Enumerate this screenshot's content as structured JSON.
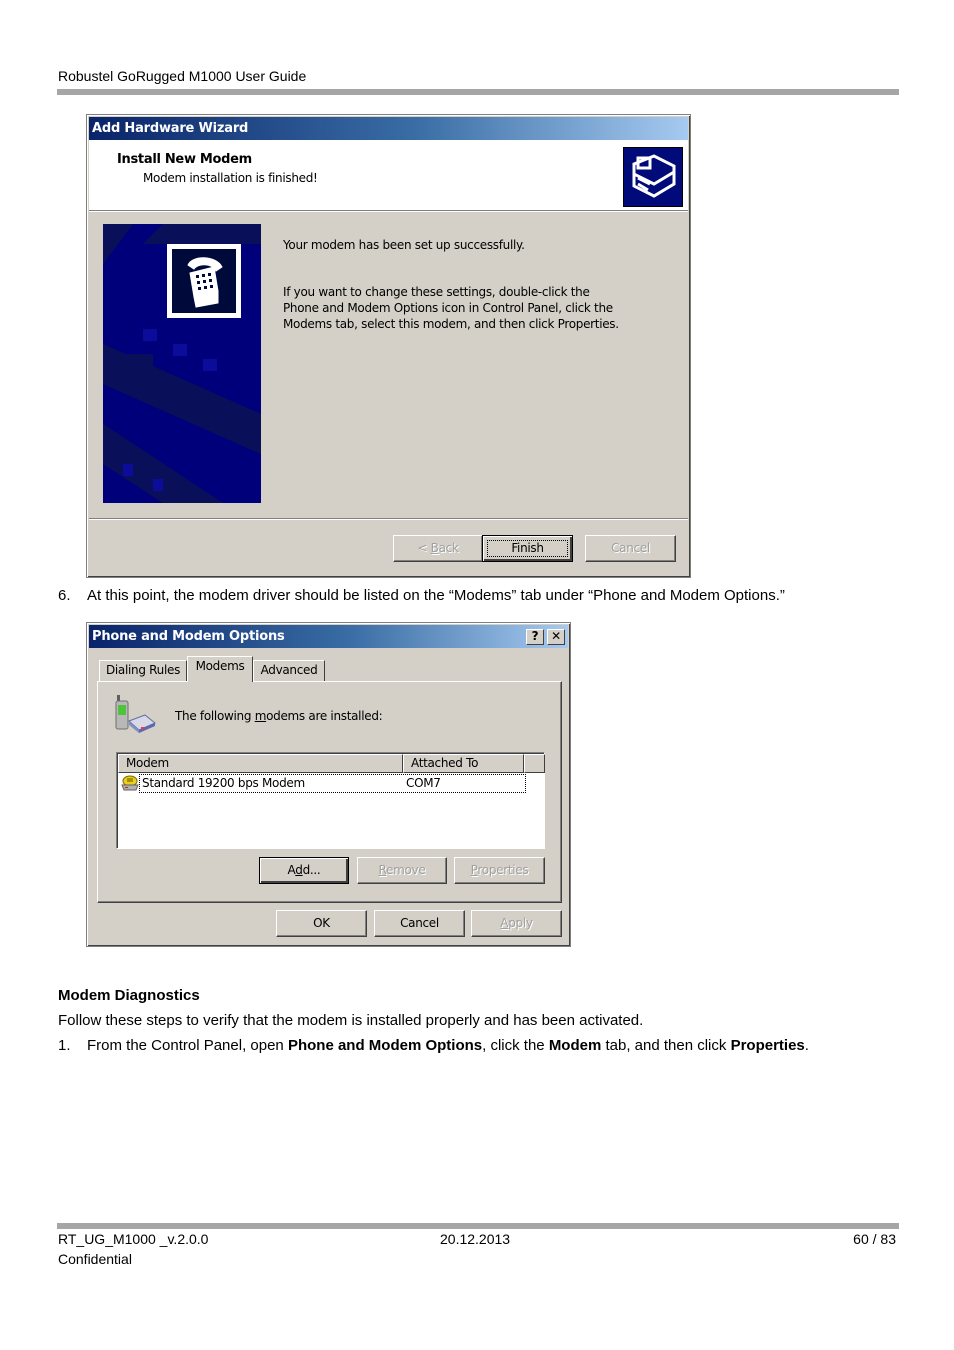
{
  "document": {
    "header_title": "Robustel GoRugged M1000 User Guide",
    "footer": {
      "doc_id": "RT_UG_M1000 _v.2.0.0",
      "date": "20.12.2013",
      "page": "60 / 83",
      "classification": "Confidential"
    }
  },
  "wizard": {
    "title": "Add Hardware Wizard",
    "heading": "Install New Modem",
    "subheading": "Modem installation is finished!",
    "header_icon": "hardware-install-icon",
    "side_icon": "telephone-icon",
    "message1": "Your modem has been set up successfully.",
    "message2_lines": [
      "If you want to change these settings, double-click the",
      "Phone and Modem Options icon in Control Panel, click the",
      "Modems tab, select this modem, and then click Properties."
    ],
    "buttons": {
      "back": {
        "pre": "< ",
        "accel": "B",
        "rest": "ack",
        "enabled": false
      },
      "finish": {
        "label": "Finish",
        "enabled": true
      },
      "cancel": {
        "label": "Cancel",
        "enabled": false
      }
    }
  },
  "step6": {
    "number": "6.",
    "text": "At this point, the modem driver should be listed on the “Modems” tab under “Phone and Modem Options.”"
  },
  "phone_dialog": {
    "title": "Phone and Modem Options",
    "help_label": "?",
    "close_label": "✕",
    "tabs": [
      {
        "label": "Dialing Rules",
        "active": false
      },
      {
        "label": "Modems",
        "active": true
      },
      {
        "label": "Advanced",
        "active": false
      }
    ],
    "intro": {
      "pre": "The following ",
      "accel": "m",
      "rest": "odems are  installed:"
    },
    "intro_icon": "phone-modem-icon",
    "list": {
      "columns": [
        "Modem",
        "Attached To"
      ],
      "rows": [
        {
          "icon": "modem-icon",
          "modem": "Standard 19200 bps Modem",
          "attached_to": "COM7",
          "selected": true
        }
      ]
    },
    "buttons": {
      "add": {
        "pre": "A",
        "accel": "d",
        "rest": "d...",
        "enabled": true
      },
      "remove": {
        "pre": "",
        "accel": "R",
        "rest": "emove",
        "enabled": false
      },
      "properties": {
        "pre": "",
        "accel": "P",
        "rest": "roperties",
        "enabled": false
      },
      "ok": {
        "label": "OK",
        "enabled": true
      },
      "cancel": {
        "label": "Cancel",
        "enabled": true
      },
      "apply": {
        "pre": "",
        "accel": "A",
        "rest": "pply",
        "enabled": false
      }
    }
  },
  "diagnostics": {
    "heading": "Modem Diagnostics",
    "intro": "Follow these steps to verify that the modem is installed properly and has been activated.",
    "step1": {
      "number": "1.",
      "parts": [
        {
          "text": "From the Control Panel, open ",
          "bold": false
        },
        {
          "text": "Phone and Modem Options",
          "bold": true
        },
        {
          "text": ", click the ",
          "bold": false
        },
        {
          "text": "Modem",
          "bold": true
        },
        {
          "text": " tab, and then click ",
          "bold": false
        },
        {
          "text": "Properties",
          "bold": true
        },
        {
          "text": ".",
          "bold": false
        }
      ]
    }
  }
}
